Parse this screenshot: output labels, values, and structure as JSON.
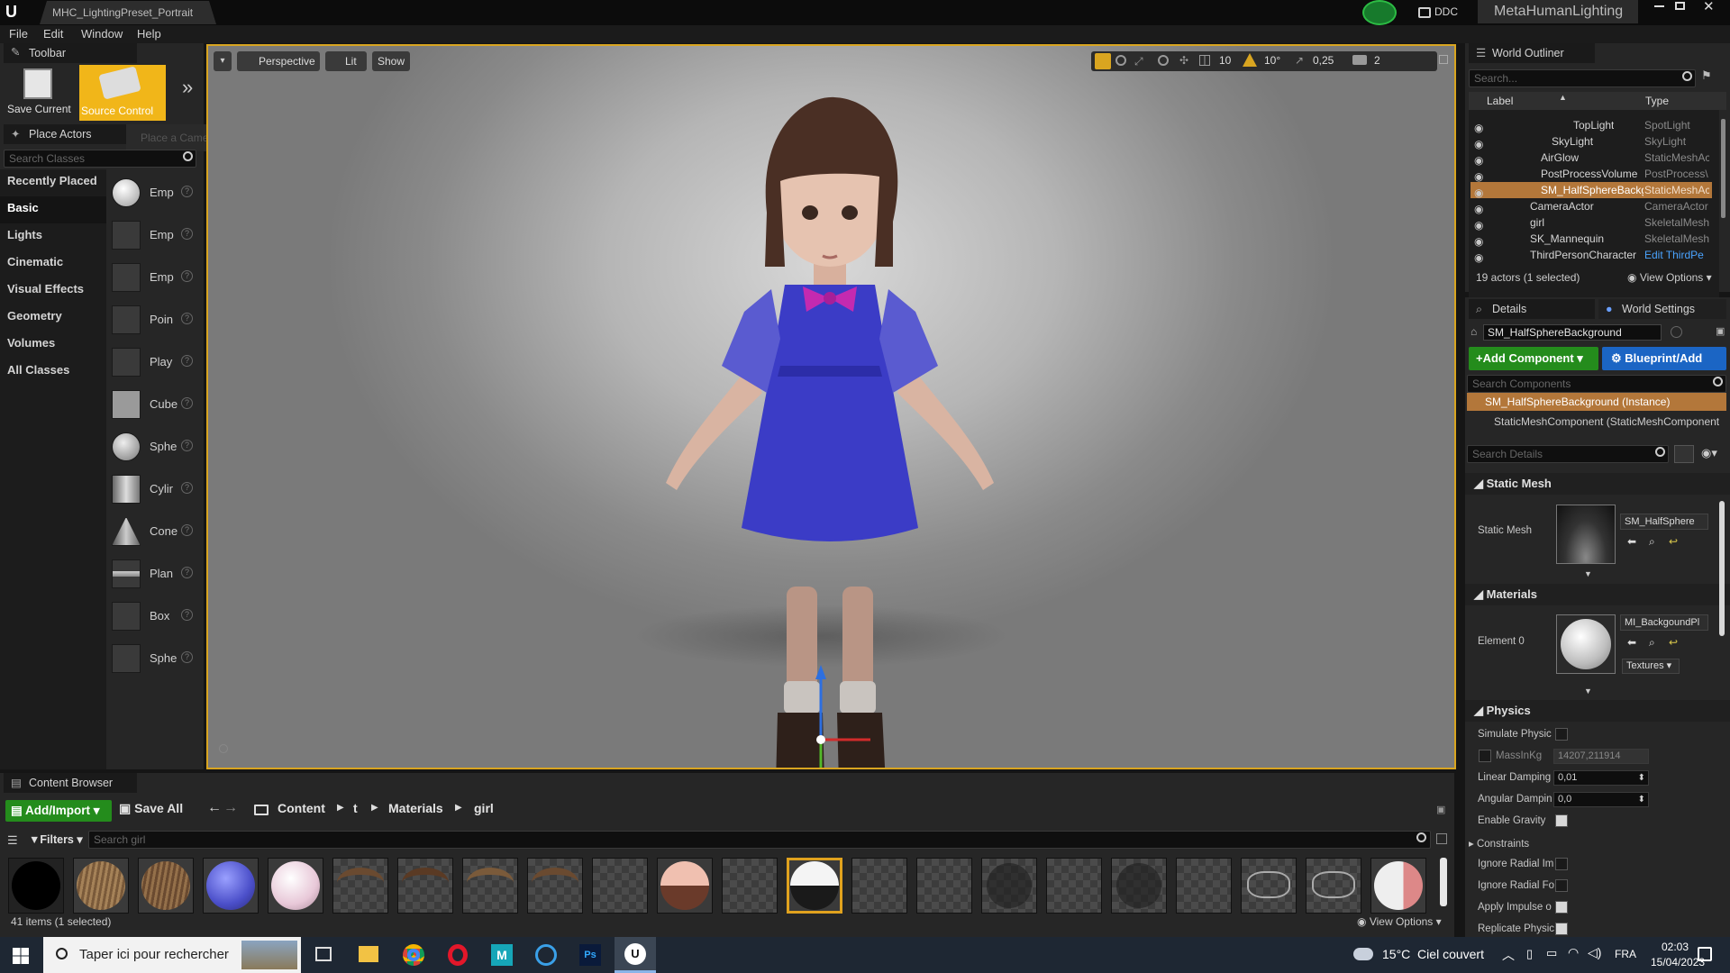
{
  "app": {
    "document_tab": "MHC_LightingPreset_Portrait",
    "ddc_label": "DDC",
    "project_name": "MetaHumanLighting"
  },
  "menu": [
    "File",
    "Edit",
    "Window",
    "Help"
  ],
  "toolbar": {
    "tab": "Toolbar",
    "save_label": "Save Current",
    "source_control_label": "Source Control"
  },
  "place_actors": {
    "tab": "Place Actors",
    "search_placeholder": "Search Classes",
    "tooltip": "Place a Camera Actor",
    "categories": [
      "Recently Placed",
      "Basic",
      "Lights",
      "Cinematic",
      "Visual Effects",
      "Geometry",
      "Volumes",
      "All Classes"
    ],
    "selected_category": "Basic",
    "items": [
      "Emp",
      "Emp",
      "Emp",
      "Poin",
      "Play",
      "Cube",
      "Sphe",
      "Cylir",
      "Cone",
      "Plan",
      "Box",
      "Sphe"
    ]
  },
  "viewport": {
    "view_mode": "Perspective",
    "lighting": "Lit",
    "show_label": "Show",
    "grid_snap": "10",
    "rot_snap": "10°",
    "scale_snap": "0,25",
    "camera_speed": "2"
  },
  "outliner": {
    "tab": "World Outliner",
    "search_placeholder": "Search...",
    "col_label": "Label",
    "col_type": "Type",
    "rows": [
      {
        "label": "TopLight",
        "type": "SpotLight"
      },
      {
        "label": "SkyLight",
        "type": "SkyLight"
      },
      {
        "label": "AirGlow",
        "type": "StaticMeshAc"
      },
      {
        "label": "PostProcessVolume",
        "type": "PostProcess\\"
      },
      {
        "label": "SM_HalfSphereBackg",
        "type": "StaticMeshAc"
      },
      {
        "label": "CameraActor",
        "type": "CameraActor"
      },
      {
        "label": "girl",
        "type": "SkeletalMesh"
      },
      {
        "label": "SK_Mannequin",
        "type": "SkeletalMesh"
      },
      {
        "label": "ThirdPersonCharacter",
        "type": "Edit ThirdPe"
      }
    ],
    "summary": "19 actors (1 selected)",
    "view_options": "View Options"
  },
  "details": {
    "tab": "Details",
    "world_settings_tab": "World Settings",
    "actor_name": "SM_HalfSphereBackground",
    "add_component": "Add Component",
    "blueprint": "Blueprint/Add",
    "search_components_placeholder": "Search Components",
    "instance_row": "SM_HalfSphereBackground (Instance)",
    "component_row": "StaticMeshComponent (StaticMeshComponent",
    "search_details_placeholder": "Search Details",
    "static_mesh_section": "Static Mesh",
    "static_mesh_label": "Static Mesh",
    "static_mesh_value": "SM_HalfSphere",
    "materials_section": "Materials",
    "element0_label": "Element 0",
    "element0_value": "MI_BackgoundPl",
    "textures_label": "Textures",
    "physics_section": "Physics",
    "physics": {
      "simulate": "Simulate Physic",
      "mass_label": "MassInKg",
      "mass_value": "14207,211914",
      "linear_label": "Linear Damping",
      "linear_value": "0,01",
      "angular_label": "Angular Dampin",
      "angular_value": "0,0",
      "gravity_label": "Enable Gravity",
      "constraints_label": "Constraints",
      "ignore_radial_im": "Ignore Radial Im",
      "ignore_radial_fo": "Ignore Radial Fo",
      "apply_impulse": "Apply Impulse o",
      "replicate": "Replicate Physic"
    }
  },
  "content_browser": {
    "tab": "Content Browser",
    "add_import": "Add/Import",
    "save_all": "Save All",
    "path": [
      "Content",
      "t",
      "Materials",
      "girl"
    ],
    "filters": "Filters",
    "search_placeholder": "Search girl",
    "status": "41 items (1 selected)",
    "view_options": "View Options"
  },
  "taskbar": {
    "search_placeholder": "Taper ici pour rechercher",
    "weather": "15°C  Ciel couvert",
    "lang": "FRA",
    "time": "02:03",
    "date": "15/04/2023"
  }
}
